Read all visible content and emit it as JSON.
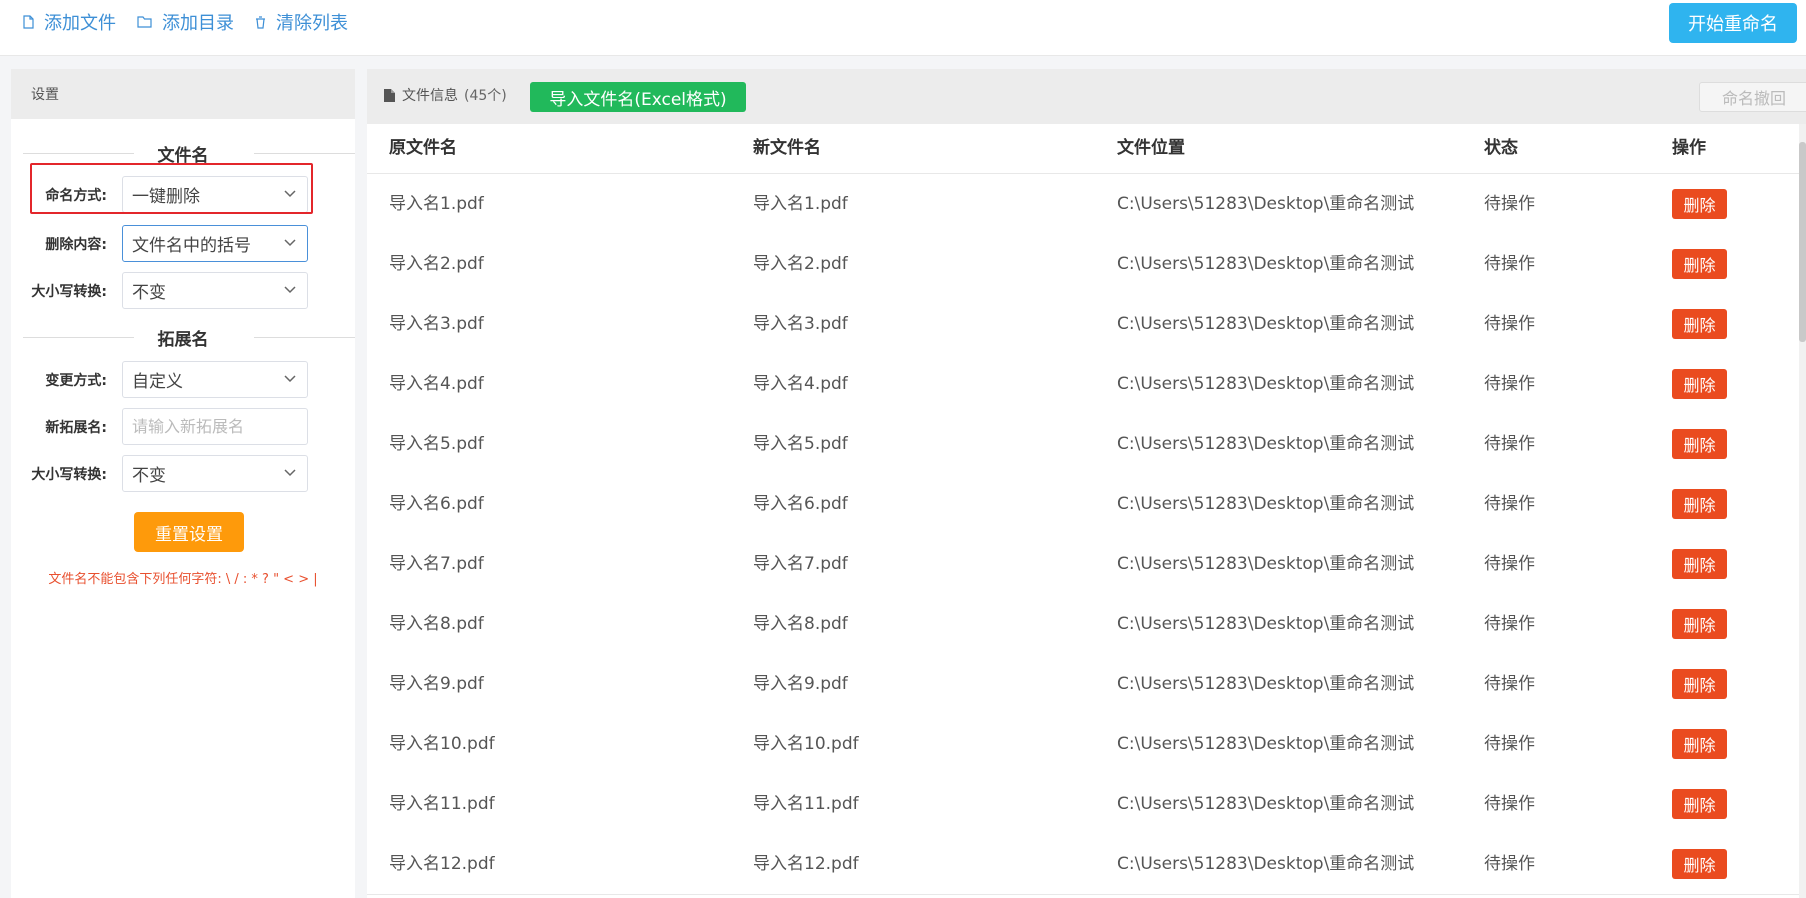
{
  "toolbar": {
    "add_file": "添加文件",
    "add_dir": "添加目录",
    "clear_list": "清除列表",
    "start_rename": "开始重命名"
  },
  "settings": {
    "header": "设置",
    "filename_section": "文件名",
    "naming_method_label": "命名方式:",
    "naming_method_value": "一键删除",
    "delete_content_label": "删除内容:",
    "delete_content_value": "文件名中的括号",
    "case_label": "大小写转换:",
    "case_value": "不变",
    "ext_section": "拓展名",
    "change_method_label": "变更方式:",
    "change_method_value": "自定义",
    "new_ext_label": "新拓展名:",
    "new_ext_placeholder": "请输入新拓展名",
    "ext_case_label": "大小写转换:",
    "ext_case_value": "不变",
    "reset_button": "重置设置",
    "warning": "文件名不能包含下列任何字符: \\ / : * ? \" < > |"
  },
  "files_panel": {
    "info_label": "文件信息",
    "count": "(45个)",
    "import_button": "导入文件名(Excel格式)",
    "undo_button": "命名撤回",
    "columns": [
      "原文件名",
      "新文件名",
      "文件位置",
      "状态",
      "操作"
    ],
    "delete_label": "删除",
    "rows": [
      {
        "orig": "导入名1.pdf",
        "new": "导入名1.pdf",
        "path": "C:\\Users\\51283\\Desktop\\重命名测试",
        "status": "待操作"
      },
      {
        "orig": "导入名2.pdf",
        "new": "导入名2.pdf",
        "path": "C:\\Users\\51283\\Desktop\\重命名测试",
        "status": "待操作"
      },
      {
        "orig": "导入名3.pdf",
        "new": "导入名3.pdf",
        "path": "C:\\Users\\51283\\Desktop\\重命名测试",
        "status": "待操作"
      },
      {
        "orig": "导入名4.pdf",
        "new": "导入名4.pdf",
        "path": "C:\\Users\\51283\\Desktop\\重命名测试",
        "status": "待操作"
      },
      {
        "orig": "导入名5.pdf",
        "new": "导入名5.pdf",
        "path": "C:\\Users\\51283\\Desktop\\重命名测试",
        "status": "待操作"
      },
      {
        "orig": "导入名6.pdf",
        "new": "导入名6.pdf",
        "path": "C:\\Users\\51283\\Desktop\\重命名测试",
        "status": "待操作"
      },
      {
        "orig": "导入名7.pdf",
        "new": "导入名7.pdf",
        "path": "C:\\Users\\51283\\Desktop\\重命名测试",
        "status": "待操作"
      },
      {
        "orig": "导入名8.pdf",
        "new": "导入名8.pdf",
        "path": "C:\\Users\\51283\\Desktop\\重命名测试",
        "status": "待操作"
      },
      {
        "orig": "导入名9.pdf",
        "new": "导入名9.pdf",
        "path": "C:\\Users\\51283\\Desktop\\重命名测试",
        "status": "待操作"
      },
      {
        "orig": "导入名10.pdf",
        "new": "导入名10.pdf",
        "path": "C:\\Users\\51283\\Desktop\\重命名测试",
        "status": "待操作"
      },
      {
        "orig": "导入名11.pdf",
        "new": "导入名11.pdf",
        "path": "C:\\Users\\51283\\Desktop\\重命名测试",
        "status": "待操作"
      },
      {
        "orig": "导入名12.pdf",
        "new": "导入名12.pdf",
        "path": "C:\\Users\\51283\\Desktop\\重命名测试",
        "status": "待操作"
      }
    ]
  },
  "colors": {
    "accent_blue": "#2fb4ef",
    "import_green": "#21b95b",
    "reset_orange": "#fe9a0b",
    "delete_red": "#ea4b1f",
    "highlight_red": "#e3262b"
  }
}
